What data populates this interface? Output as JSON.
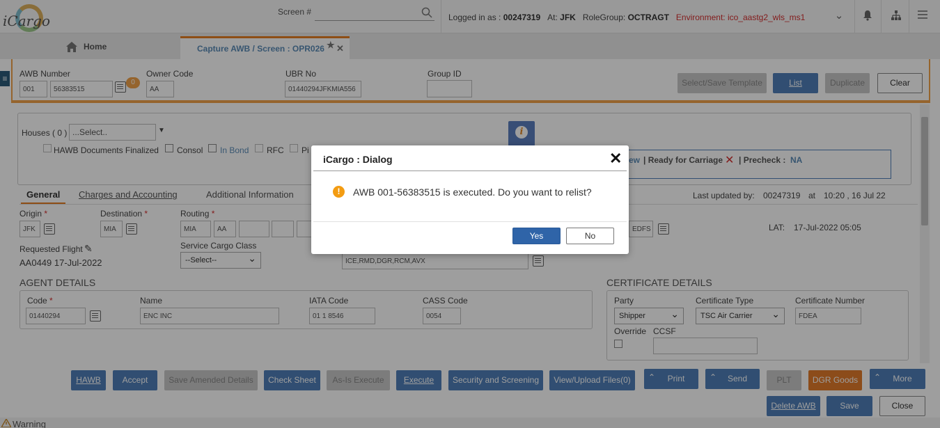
{
  "topbar": {
    "logo_text": "iCargo",
    "screen_label": "Screen #",
    "logged_in_label": "Logged in as :",
    "user_id": "00247319",
    "at_label": "At:",
    "station": "JFK",
    "role_label": "RoleGroup:",
    "role": "OCTRAGT",
    "environment": "Environment: ico_aastg2_wls_ms1",
    "icons": [
      "chevron-down-icon",
      "bell-icon",
      "sitemap-icon",
      "menu-icon"
    ]
  },
  "tabs": {
    "home": "Home",
    "active": "Capture AWB / Screen : OPR026"
  },
  "header": {
    "awb_label": "AWB Number",
    "awb_prefix": "001",
    "awb_number": "56383515",
    "awb_badge": "0",
    "owner_label": "Owner Code",
    "owner_value": "AA",
    "ubr_label": "UBR No",
    "ubr_value": "01440294JFKMIA556",
    "group_label": "Group ID",
    "group_value": "",
    "btn_template": "Select/Save Template",
    "btn_list": "List",
    "btn_duplicate": "Duplicate",
    "btn_clear": "Clear"
  },
  "houses": {
    "label": "Houses ( 0 )",
    "select_placeholder": "...Select..",
    "hawb_docs": "HAWB Documents Finalized",
    "consol": "Consol",
    "in_bond": "In Bond",
    "rfc": "RFC",
    "pi_truncated": "Pi"
  },
  "status": {
    "view_fragment": "ew",
    "ready_label": "| Ready for Carriage",
    "precheck_label": "| Precheck :",
    "precheck_value": "NA"
  },
  "subtabs": {
    "general": "General",
    "charges": "Charges and Accounting",
    "additional": "Additional Information",
    "last_updated_label": "Last updated by:",
    "last_updated_user": "00247319",
    "at": "at",
    "last_updated_time": "10:20 , 16 Jul 22"
  },
  "general": {
    "origin_label": "Origin",
    "origin_value": "JFK",
    "dest_label": "Destination",
    "dest_value": "MIA",
    "routing_label": "Routing",
    "routing_1": "MIA",
    "routing_2": "AA",
    "edfs_fragment": "EDFS",
    "lat_label": "LAT:",
    "lat_value": "17-Jul-2022   05:05",
    "req_flight_label": "Requested Flight",
    "req_flight_value": "AA0449 17-Jul-2022",
    "scc_label": "Service Cargo Class",
    "scc_value": "--Select--",
    "shc_value": "ICE,RMD,DGR,RCM,AVX"
  },
  "agent": {
    "title": "AGENT DETAILS",
    "code_label": "Code",
    "code_value": "01440294",
    "name_label": "Name",
    "name_value": "ENC INC",
    "iata_label": "IATA Code",
    "iata_value": "01 1 8546",
    "cass_label": "CASS Code",
    "cass_value": "0054"
  },
  "certificate": {
    "title": "CERTIFICATE DETAILS",
    "party_label": "Party",
    "party_value": "Shipper",
    "type_label": "Certificate Type",
    "type_value": "TSC Air Carrier",
    "number_label": "Certificate Number",
    "number_value": "FDEA",
    "override_label": "Override",
    "ccsf_label": "CCSF"
  },
  "footer": {
    "hawb": "HAWB",
    "accept": "Accept",
    "save_amended": "Save Amended Details",
    "check_sheet": "Check Sheet",
    "as_is_execute": "As-Is Execute",
    "execute": "Execute",
    "security": "Security and Screening",
    "view_upload": "View/Upload Files(0)",
    "print": "Print",
    "send": "Send",
    "plt": "PLT",
    "dgr": "DGR Goods",
    "more": "More",
    "delete_awb": "Delete AWB",
    "save": "Save",
    "close": "Close",
    "warning": "Warning"
  },
  "dialog": {
    "title": "iCargo : Dialog",
    "message": "AWB 001-56383515 is executed. Do you want to relist?",
    "yes": "Yes",
    "no": "No"
  },
  "colors": {
    "accent_orange": "#e67e22",
    "primary_blue": "#2f64a8",
    "environment_red": "#d32f2f",
    "warning_icon": "#f39c12"
  }
}
